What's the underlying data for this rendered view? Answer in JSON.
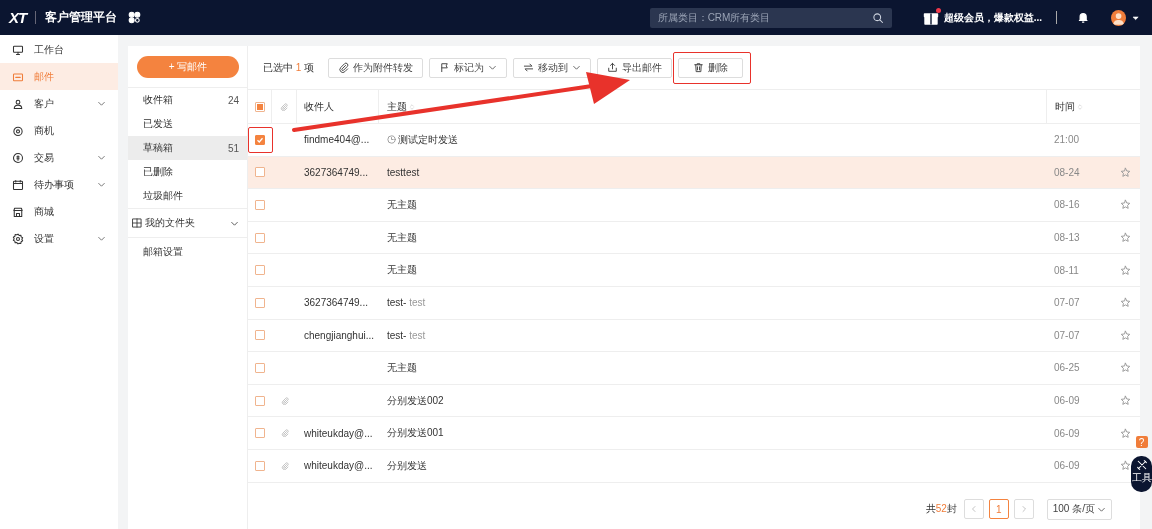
{
  "topbar": {
    "logo": "XT",
    "title": "客户管理平台",
    "search": {
      "placeholder": "所属类目：CRM所有类目"
    },
    "promo": "超级会员，爆款权益...",
    "promo_dot": true
  },
  "sidebar": {
    "items": [
      {
        "label": "工作台",
        "selected": false,
        "expandable": false
      },
      {
        "label": "邮件",
        "selected": true,
        "expandable": false
      },
      {
        "label": "客户",
        "selected": false,
        "expandable": true
      },
      {
        "label": "商机",
        "selected": false,
        "expandable": false
      },
      {
        "label": "交易",
        "selected": false,
        "expandable": true
      },
      {
        "label": "待办事项",
        "selected": false,
        "expandable": true
      },
      {
        "label": "商城",
        "selected": false,
        "expandable": false
      },
      {
        "label": "设置",
        "selected": false,
        "expandable": true
      }
    ]
  },
  "mail_folders": {
    "compose": "+ 写邮件",
    "folders": [
      {
        "label": "收件箱",
        "count": "24",
        "selected": false
      },
      {
        "label": "已发送",
        "selected": false
      },
      {
        "label": "草稿箱",
        "count": "51",
        "selected": true
      },
      {
        "label": "已删除",
        "selected": false
      },
      {
        "label": "垃圾邮件",
        "selected": false
      }
    ],
    "my_folders": "我的文件夹",
    "settings": "邮箱设置"
  },
  "toolbar": {
    "selected_prefix": "已选中",
    "selected_count": "1",
    "selected_suffix": "项",
    "buttons": [
      {
        "label": "作为附件转发",
        "dropdown": false,
        "highlighted": false
      },
      {
        "label": "标记为",
        "dropdown": true,
        "highlighted": false
      },
      {
        "label": "移动到",
        "dropdown": true,
        "highlighted": false
      },
      {
        "label": "导出邮件",
        "dropdown": false,
        "highlighted": false
      },
      {
        "label": "删除",
        "dropdown": false,
        "highlighted": true
      }
    ]
  },
  "table": {
    "header_checkbox": {
      "indeterminate": true
    },
    "columns": {
      "recipient": "收件人",
      "subject": "主题",
      "time": "时间"
    },
    "rows": [
      {
        "checked": true,
        "highlighted": true,
        "hover": false,
        "attachment": false,
        "scheduled": true,
        "recipient": "findme404@...",
        "subject": "测试定时发送",
        "time": "21:00",
        "star": false
      },
      {
        "checked": false,
        "highlighted": false,
        "hover": true,
        "attachment": false,
        "scheduled": false,
        "recipient": "3627364749...",
        "subject": "testtest",
        "time": "08-24",
        "star": true
      },
      {
        "checked": false,
        "highlighted": false,
        "hover": false,
        "attachment": false,
        "scheduled": false,
        "subject": "无主题",
        "time": "08-16",
        "star": true
      },
      {
        "checked": false,
        "highlighted": false,
        "hover": false,
        "attachment": false,
        "scheduled": false,
        "subject": "无主题",
        "time": "08-13",
        "star": true
      },
      {
        "checked": false,
        "highlighted": false,
        "hover": false,
        "attachment": false,
        "scheduled": false,
        "subject": "无主题",
        "time": "08-11",
        "star": true
      },
      {
        "checked": false,
        "highlighted": false,
        "hover": false,
        "attachment": false,
        "scheduled": false,
        "recipient": "3627364749...",
        "subject": "test-",
        "preview": "test",
        "time": "07-07",
        "star": true
      },
      {
        "checked": false,
        "highlighted": false,
        "hover": false,
        "attachment": false,
        "scheduled": false,
        "recipient": "chengjianghui...",
        "subject": "test-",
        "preview": "test",
        "time": "07-07",
        "star": true
      },
      {
        "checked": false,
        "highlighted": false,
        "hover": false,
        "attachment": false,
        "scheduled": false,
        "subject": "无主题",
        "time": "06-25",
        "star": true
      },
      {
        "checked": false,
        "highlighted": false,
        "hover": false,
        "attachment": true,
        "scheduled": false,
        "subject": "分别发送002",
        "time": "06-09",
        "star": true
      },
      {
        "checked": false,
        "highlighted": false,
        "hover": false,
        "attachment": true,
        "scheduled": false,
        "recipient": "whiteukday@...",
        "subject": "分别发送001",
        "time": "06-09",
        "star": true
      },
      {
        "checked": false,
        "highlighted": false,
        "hover": false,
        "attachment": true,
        "scheduled": false,
        "recipient": "whiteukday@...",
        "subject": "分别发送",
        "time": "06-09",
        "star": true
      }
    ]
  },
  "pagination": {
    "total_prefix": "共",
    "total": "52",
    "total_suffix": "封",
    "pages": [
      {
        "label": "1",
        "selected": true
      }
    ],
    "page_size": "100 条/页"
  },
  "float_tools": {
    "help": "?",
    "tools": "工具"
  }
}
